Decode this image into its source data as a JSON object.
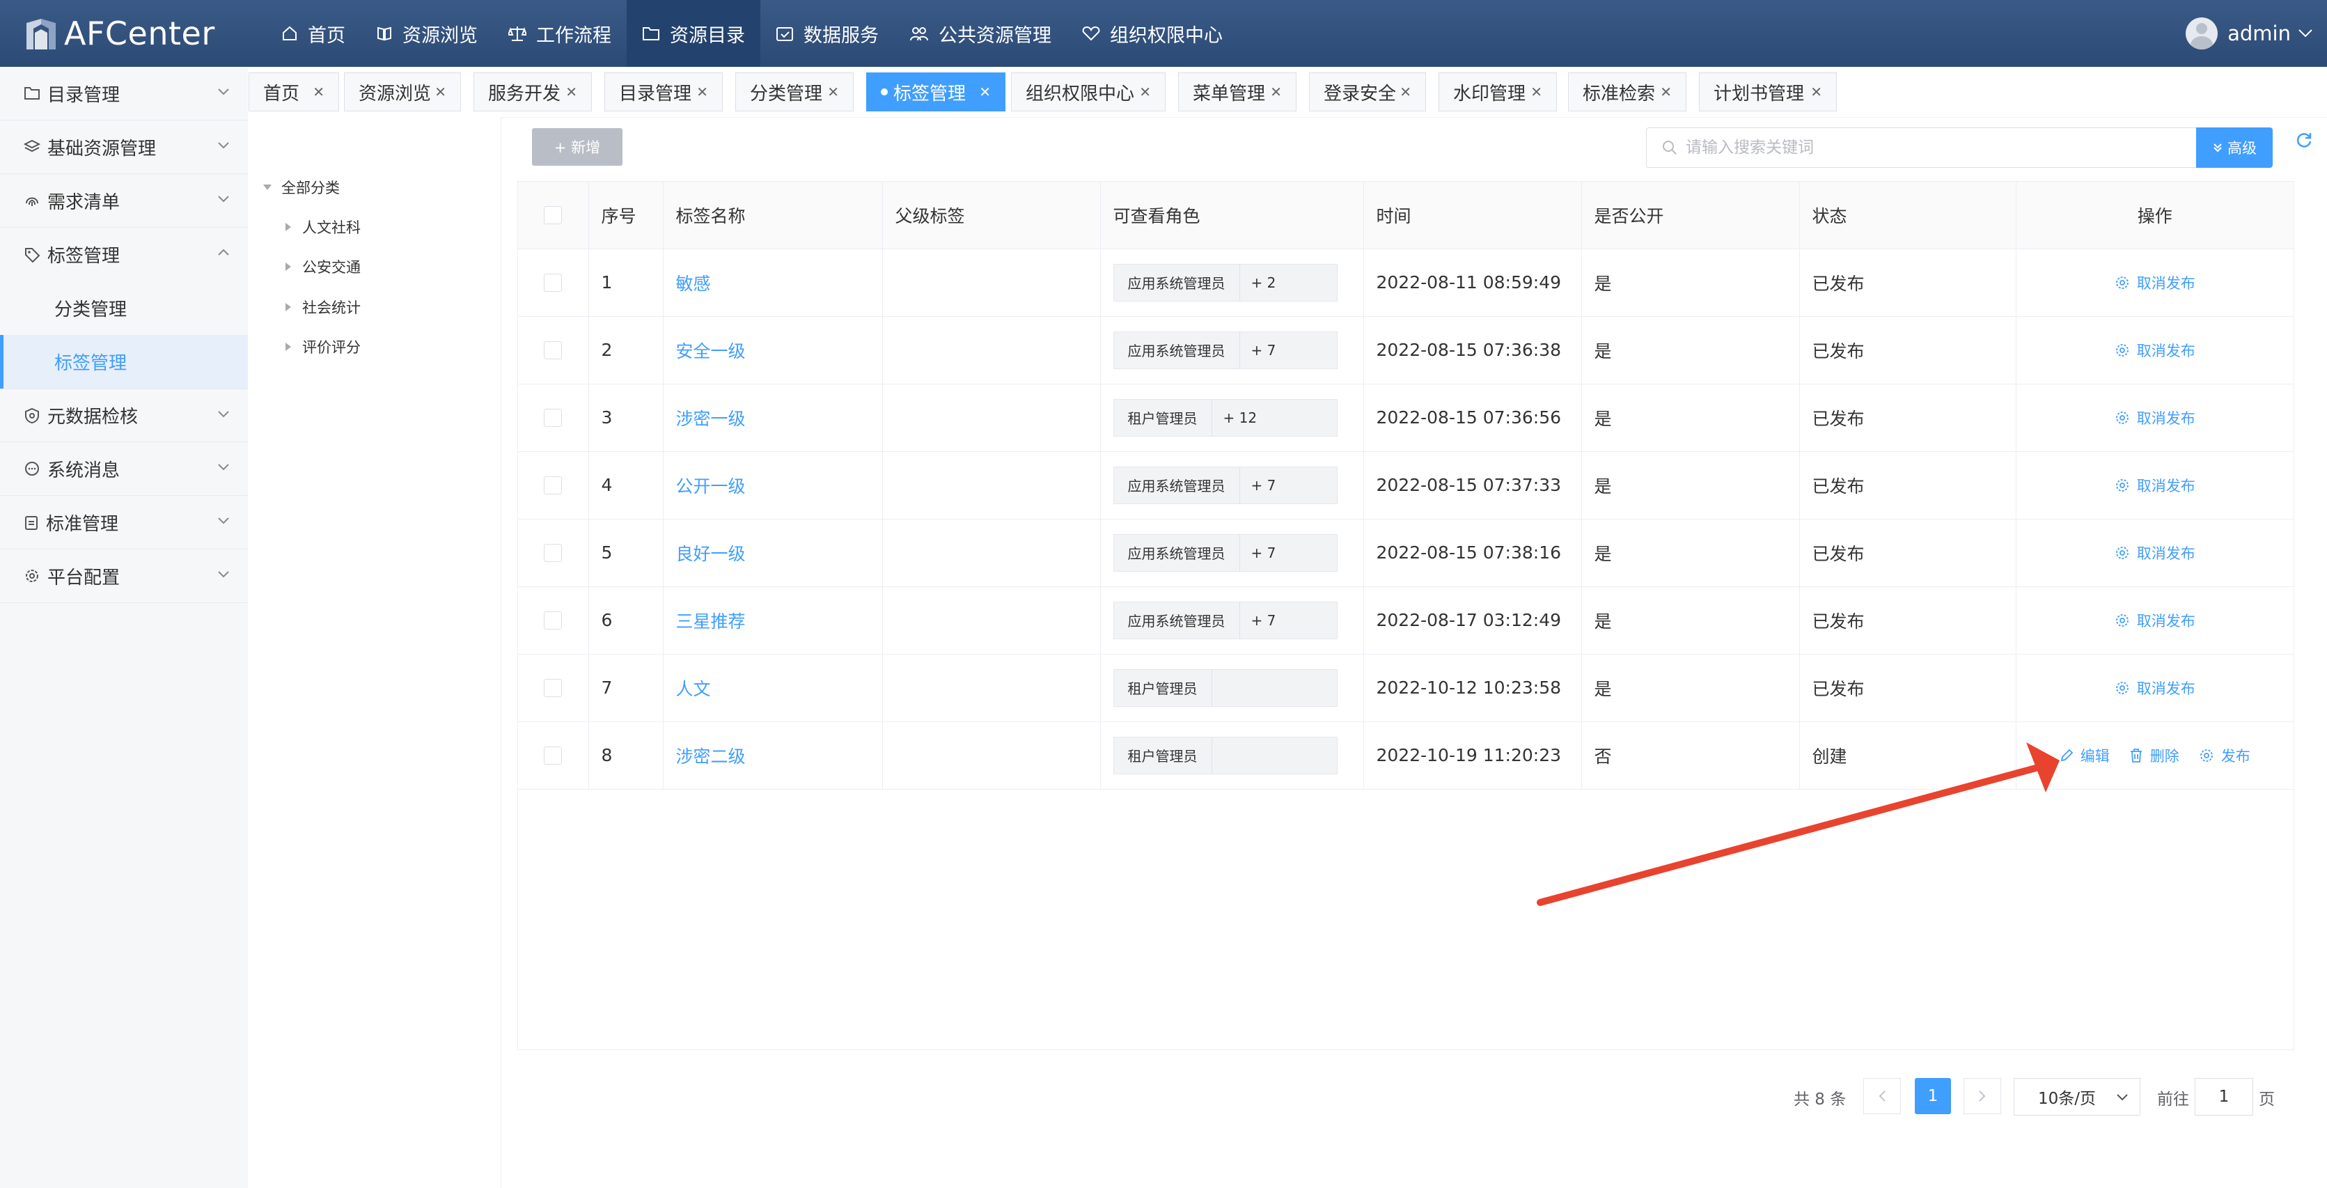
{
  "app": {
    "title": "AFCenter",
    "user": "admin"
  },
  "topnav": [
    {
      "label": "首页",
      "icon": "home-icon"
    },
    {
      "label": "资源浏览",
      "icon": "book-icon"
    },
    {
      "label": "工作流程",
      "icon": "scale-icon"
    },
    {
      "label": "资源目录",
      "icon": "folder-icon",
      "active": true
    },
    {
      "label": "数据服务",
      "icon": "calendar-check-icon"
    },
    {
      "label": "公共资源管理",
      "icon": "users-icon"
    },
    {
      "label": "组织权限中心",
      "icon": "heart-icon"
    }
  ],
  "sidebar": {
    "items": [
      {
        "label": "目录管理",
        "icon": "folder-icon"
      },
      {
        "label": "基础资源管理",
        "icon": "layers-icon"
      },
      {
        "label": "需求清单",
        "icon": "fingerprint-icon"
      },
      {
        "label": "标签管理",
        "icon": "tag-icon",
        "expanded": true,
        "children": [
          {
            "label": "分类管理"
          },
          {
            "label": "标签管理",
            "active": true
          }
        ]
      },
      {
        "label": "元数据检核",
        "icon": "shield-icon"
      },
      {
        "label": "系统消息",
        "icon": "chat-icon"
      },
      {
        "label": "标准管理",
        "icon": "clipboard-icon"
      },
      {
        "label": "平台配置",
        "icon": "gear-icon"
      }
    ]
  },
  "tabs": [
    {
      "label": "首页"
    },
    {
      "label": "资源浏览"
    },
    {
      "label": "服务开发"
    },
    {
      "label": "目录管理"
    },
    {
      "label": "分类管理"
    },
    {
      "label": "标签管理",
      "active": true
    },
    {
      "label": "组织权限中心"
    },
    {
      "label": "菜单管理"
    },
    {
      "label": "登录安全"
    },
    {
      "label": "水印管理"
    },
    {
      "label": "标准检索"
    },
    {
      "label": "计划书管理"
    }
  ],
  "tree": {
    "root": "全部分类",
    "nodes": [
      "人文社科",
      "公安交通",
      "社会统计",
      "评价评分"
    ]
  },
  "toolbar": {
    "new_label": "+ 新增",
    "search_placeholder": "请输入搜索关键词",
    "advanced_label": "高级"
  },
  "table": {
    "columns": [
      "序号",
      "标签名称",
      "父级标签",
      "可查看角色",
      "时间",
      "是否公开",
      "状态",
      "操作"
    ],
    "rows": [
      {
        "no": "1",
        "name": "敏感",
        "parent": "",
        "role": "应用系统管理员",
        "more": "+ 2",
        "time": "2022-08-11 08:59:49",
        "public": "是",
        "status": "已发布",
        "actions": [
          "取消发布"
        ]
      },
      {
        "no": "2",
        "name": "安全一级",
        "parent": "",
        "role": "应用系统管理员",
        "more": "+ 7",
        "time": "2022-08-15 07:36:38",
        "public": "是",
        "status": "已发布",
        "actions": [
          "取消发布"
        ]
      },
      {
        "no": "3",
        "name": "涉密一级",
        "parent": "",
        "role": "租户管理员",
        "more": "+ 12",
        "time": "2022-08-15 07:36:56",
        "public": "是",
        "status": "已发布",
        "actions": [
          "取消发布"
        ]
      },
      {
        "no": "4",
        "name": "公开一级",
        "parent": "",
        "role": "应用系统管理员",
        "more": "+ 7",
        "time": "2022-08-15 07:37:33",
        "public": "是",
        "status": "已发布",
        "actions": [
          "取消发布"
        ]
      },
      {
        "no": "5",
        "name": "良好一级",
        "parent": "",
        "role": "应用系统管理员",
        "more": "+ 7",
        "time": "2022-08-15 07:38:16",
        "public": "是",
        "status": "已发布",
        "actions": [
          "取消发布"
        ]
      },
      {
        "no": "6",
        "name": "三星推荐",
        "parent": "",
        "role": "应用系统管理员",
        "more": "+ 7",
        "time": "2022-08-17 03:12:49",
        "public": "是",
        "status": "已发布",
        "actions": [
          "取消发布"
        ]
      },
      {
        "no": "7",
        "name": "人文",
        "parent": "",
        "role": "租户管理员",
        "more": "",
        "time": "2022-10-12 10:23:58",
        "public": "是",
        "status": "已发布",
        "actions": [
          "取消发布"
        ]
      },
      {
        "no": "8",
        "name": "涉密二级",
        "parent": "",
        "role": "租户管理员",
        "more": "",
        "time": "2022-10-19 11:20:23",
        "public": "否",
        "status": "创建",
        "actions": [
          "编辑",
          "删除",
          "发布"
        ]
      }
    ]
  },
  "pagination": {
    "total_text": "共 8 条",
    "current_page": "1",
    "page_size": "10条/页",
    "goto_label": "前往",
    "goto_value": "1",
    "page_suffix": "页"
  },
  "colors": {
    "topbar": "#2f4e7b",
    "accent": "#409eff",
    "annotation_arrow": "#e8432f"
  }
}
